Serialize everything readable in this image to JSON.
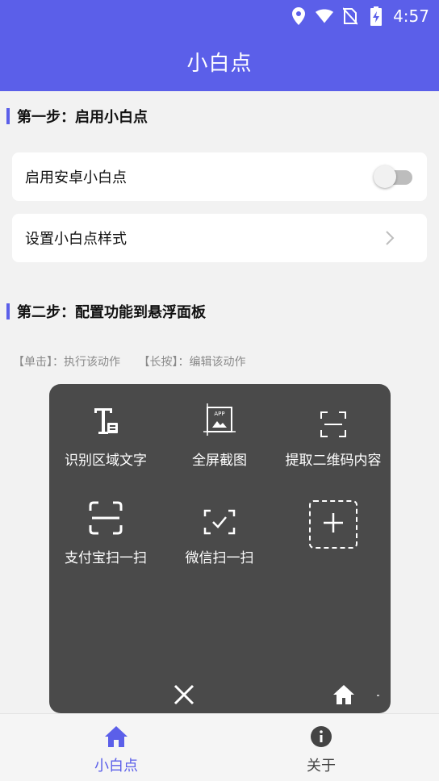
{
  "status_bar": {
    "time": "4:57",
    "icons": [
      "location-icon",
      "wifi-icon",
      "no-sim-icon",
      "battery-charging-icon"
    ]
  },
  "app_bar": {
    "title": "小白点"
  },
  "section1": {
    "title": "第一步：启用小白点"
  },
  "settings": {
    "enable": {
      "label": "启用安卓小白点",
      "toggle_state": "off"
    },
    "style": {
      "label": "设置小白点样式"
    }
  },
  "section2": {
    "title": "第二步：配置功能到悬浮面板"
  },
  "hint": {
    "tap": "【单击】：执行该动作",
    "long_press": "【长按】：编辑该动作"
  },
  "panel": {
    "items": [
      {
        "label": "识别区域文字",
        "icon": "text-recognition-icon"
      },
      {
        "label": "全屏截图",
        "icon": "app-screenshot-icon"
      },
      {
        "label": "提取二维码内容",
        "icon": "qr-scan-icon"
      },
      {
        "label": "支付宝扫一扫",
        "icon": "alipay-scan-icon"
      },
      {
        "label": "微信扫一扫",
        "icon": "wechat-scan-icon"
      }
    ],
    "add_icon": "add-icon",
    "close_icon": "close-icon",
    "home_icon": "home-icon"
  },
  "bottom_nav": {
    "items": [
      {
        "label": "小白点",
        "icon": "home-icon",
        "active": true
      },
      {
        "label": "关于",
        "icon": "info-icon",
        "active": false
      }
    ]
  },
  "colors": {
    "accent": "#5b5fe9",
    "panel_bg": "#4a4a4a",
    "page_bg": "#f2f2f2",
    "inactive_nav": "#444444"
  }
}
